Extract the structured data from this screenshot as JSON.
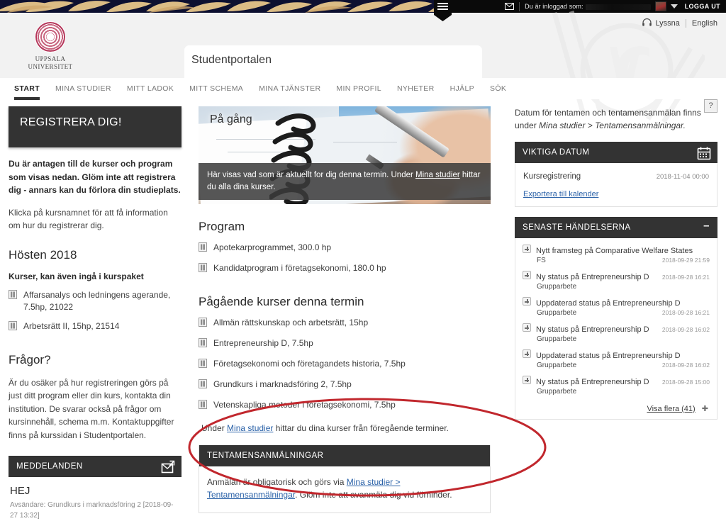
{
  "topbar": {
    "mail_icon": "envelope-icon",
    "logged_in_label": "Du är inloggad som:",
    "logged_in_user": "",
    "logout_label": "LOGGA UT",
    "menu_icon": "hamburger-icon"
  },
  "header": {
    "logo_line1": "UPPSALA",
    "logo_line2": "UNIVERSITET",
    "site_title": "Studentportalen",
    "listen_label": "Lyssna",
    "language_label": "English",
    "listen_icon": "headphones-icon"
  },
  "nav": {
    "items": [
      {
        "label": "START",
        "active": true
      },
      {
        "label": "MINA STUDIER",
        "active": false
      },
      {
        "label": "MITT LADOK",
        "active": false
      },
      {
        "label": "MITT SCHEMA",
        "active": false
      },
      {
        "label": "MINA TJÄNSTER",
        "active": false
      },
      {
        "label": "MIN PROFIL",
        "active": false
      },
      {
        "label": "NYHETER",
        "active": false
      },
      {
        "label": "HJÄLP",
        "active": false
      },
      {
        "label": "SÖK",
        "active": false
      }
    ]
  },
  "left": {
    "banner_title": "REGISTRERA DIG!",
    "intro_bold": "Du är antagen till de kurser och program som visas nedan. Glöm inte att registrera dig - annars kan du förlora din studieplats.",
    "intro_text": "Klicka på kursnamnet för att få information om hur du registrerar dig.",
    "term_heading": "Hösten 2018",
    "courses_subheading": "Kurser, kan även ingå i kurspaket",
    "courses": [
      {
        "label": "Affarsanalys och ledningens agerande, 7.5hp, 21022"
      },
      {
        "label": "Arbetsrätt II, 15hp, 21514"
      }
    ],
    "questions_heading": "Frågor?",
    "questions_text": "Är du osäker på hur registreringen görs på just ditt program eller din kurs, kontakta din institution. De svarar också på frågor om kursinnehåll, schema m.m. Kontaktuppgifter finns på kurssidan i Studentportalen.",
    "messages": {
      "title": "MEDDELANDEN",
      "icon": "message-box-icon",
      "subject": "HEJ",
      "meta": "Avsändare: Grundkurs i marknadsföring 2 [2018-09-27 13:32]"
    }
  },
  "mid": {
    "banner_title": "På gång",
    "banner_text_before": "Här visas vad som är aktuellt for dig denna termin. Under ",
    "banner_link": "Mina studier",
    "banner_text_after": " hittar du alla dina kurser.",
    "program_heading": "Program",
    "programs": [
      {
        "label": "Apotekarprogrammet, 300.0 hp"
      },
      {
        "label": "Kandidatprogram i företagsekonomi, 180.0 hp"
      }
    ],
    "current_heading": "Pågående kurser denna termin",
    "current_courses": [
      {
        "label": "Allmän rättskunskap och arbetsrätt, 15hp"
      },
      {
        "label": "Entrepreneurship D, 7.5hp"
      },
      {
        "label": "Företagsekonomi och företagandets historia, 7.5hp"
      },
      {
        "label": "Grundkurs i marknadsföring 2, 7.5hp"
      },
      {
        "label": "Vetenskapliga metoder i företagsekonomi, 7.5hp"
      }
    ],
    "under_text_before": "Under ",
    "under_link": "Mina studier",
    "under_text_after": " hittar du dina kurser från föregående terminer.",
    "exam_title": "TENTAMENSANMÄLNINGAR",
    "exam_text_before": "Anmälan är obligatorisk och görs via ",
    "exam_link": "Mina studier > Tentamensanmälningar",
    "exam_text_after": ". Glöm inte att avanmäla dig vid förhinder."
  },
  "right": {
    "help_icon": "question-mark-icon",
    "intro_text": "Datum för tentamen och tentamensanmälan finns under ",
    "intro_em": "Mina studier > Tentamensanmälningar.",
    "dates_panel": {
      "title": "VIKTIGA DATUM",
      "icon": "calendar-icon",
      "rows": [
        {
          "label": "Kursregistrering",
          "date": "2018-11-04 00:00"
        }
      ],
      "export_link": "Exportera till kalender"
    },
    "events_panel": {
      "title": "SENASTE HÄNDELSERNA",
      "collapse_icon": "minus-icon",
      "events": [
        {
          "title": "Nytt framsteg på Comparative Welfare States",
          "sub": "FS",
          "date": "2018-09-29 21:59",
          "date_on_line": 2
        },
        {
          "title": "Ny status på Entrepreneurship D",
          "sub": "Grupparbete",
          "date": "2018-09-28 16:21",
          "date_on_line": 1
        },
        {
          "title": "Uppdaterad status på Entrepreneurship D",
          "sub": "Grupparbete",
          "date": "2018-09-28 16:21",
          "date_on_line": 2
        },
        {
          "title": "Ny status på Entrepreneurship D",
          "sub": "Grupparbete",
          "date": "2018-09-28 16:02",
          "date_on_line": 1
        },
        {
          "title": "Uppdaterad status på Entrepreneurship D",
          "sub": "Grupparbete",
          "date": "2018-09-28 16:02",
          "date_on_line": 2
        },
        {
          "title": "Ny status på Entrepreneurship D",
          "sub": "Grupparbete",
          "date": "2018-09-28 15:00",
          "date_on_line": 1
        }
      ],
      "show_more": "Visa flera (41)",
      "show_more_icon": "plus-icon"
    }
  },
  "annotation": {
    "shape": "ellipse",
    "color": "#c1272d"
  },
  "colors": {
    "dark_bar": "#333333",
    "link": "#2b62a8",
    "seal": "#b5385c",
    "topbar_navy": "#0d1030",
    "topbar_gold": "#e7c68a",
    "annotation_red": "#c1272d"
  }
}
